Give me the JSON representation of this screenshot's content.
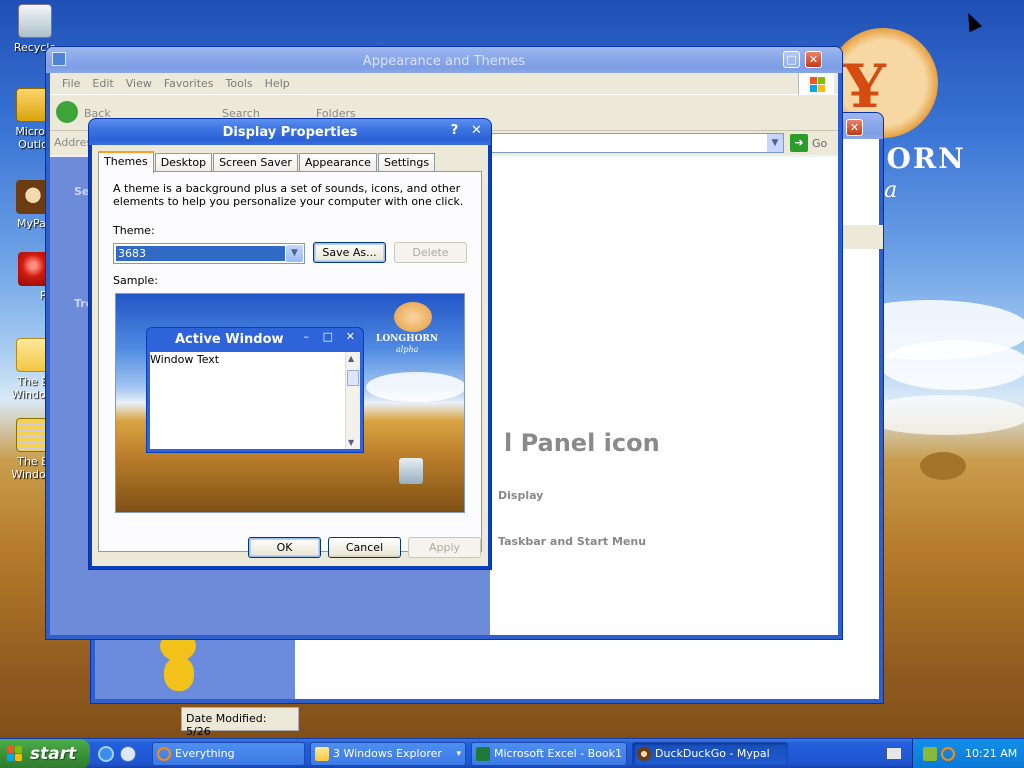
{
  "desktop": {
    "icons": [
      {
        "label": "Recycle"
      },
      {
        "label": "Micros Outlo"
      },
      {
        "label": "MyPal"
      },
      {
        "label": "Peg"
      },
      {
        "label": "The B Window"
      },
      {
        "label": "The B Window"
      }
    ],
    "logo": {
      "text": "HORN",
      "sub": "ha"
    }
  },
  "explorer": {
    "title": "Appearance and Themes",
    "menu": [
      "File",
      "Edit",
      "View",
      "Favorites",
      "Tools",
      "Help"
    ],
    "toolbar": {
      "back": "Back",
      "search": "Search",
      "folders": "Folders"
    },
    "address_label": "Addres",
    "go_label": "Go",
    "left_pane": {
      "section1": "Se",
      "section2": "Tro"
    },
    "panel_heading": "l Panel icon",
    "links": [
      "Display",
      "Taskbar and Start Menu"
    ]
  },
  "behind_window": {
    "go_label": "Go",
    "status": "Date Modified: 5/26"
  },
  "dialog": {
    "title": "Display Properties",
    "tabs": [
      "Themes",
      "Desktop",
      "Screen Saver",
      "Appearance",
      "Settings"
    ],
    "description": "A theme is a background plus a set of sounds, icons, and other elements to help you personalize your computer with one click.",
    "theme_label": "Theme:",
    "theme_value": "3683",
    "save_as": "Save As...",
    "delete": "Delete",
    "sample_label": "Sample:",
    "sample": {
      "window_title": "Active Window",
      "window_text": "Window Text",
      "logo_text": "LONGHORN",
      "logo_sub": "alpha"
    },
    "ok": "OK",
    "cancel": "Cancel",
    "apply": "Apply"
  },
  "taskbar": {
    "start": "start",
    "buttons": [
      {
        "label": "Everything",
        "icon": "search-icon"
      },
      {
        "label": "3 Windows Explorer",
        "icon": "folder-icon"
      },
      {
        "label": "Microsoft Excel - Book1",
        "icon": "excel-icon"
      },
      {
        "label": "DuckDuckGo - Mypal",
        "icon": "mypal-icon"
      }
    ],
    "clock": "10:21 AM"
  }
}
